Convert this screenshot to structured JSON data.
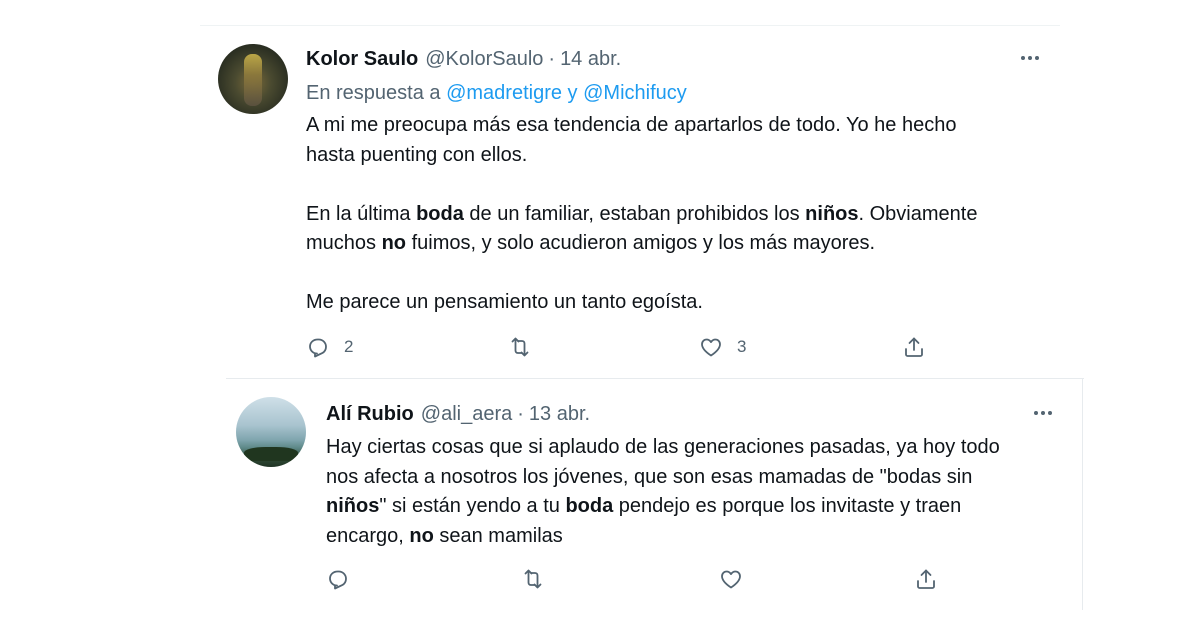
{
  "tweets": [
    {
      "name": "Kolor Saulo",
      "handle": "@KolorSaulo",
      "separator": "·",
      "date": "14 abr.",
      "reply_prefix": "En respuesta a",
      "reply_mentions": "@madretigre y @Michifucy",
      "body": {
        "p1_line1": "A mi me preocupa más esa tendencia de apartarlos de todo. Yo he hecho",
        "p1_line2": "hasta puenting con ellos.",
        "p2_a": "En la última ",
        "p2_b": "boda",
        "p2_c": " de un familiar, estaban prohibidos los ",
        "p2_d": "niños",
        "p2_e": ". Obviamente",
        "p2_f": "muchos ",
        "p2_g": "no",
        "p2_h": " fuimos, y solo acudieron amigos y los más mayores.",
        "p3": "Me parece un pensamiento un tanto egoísta."
      },
      "actions": {
        "reply_count": "2",
        "retweet_count": "",
        "like_count": "3"
      }
    },
    {
      "name": "Alí Rubio",
      "handle": "@ali_aera",
      "separator": "·",
      "date": "13 abr.",
      "body": {
        "l1": "Hay ciertas cosas que si aplaudo de las generaciones pasadas, ya hoy todo",
        "l2": "nos afecta a nosotros los jóvenes, que son esas mamadas de \"bodas sin",
        "l3_a": "niños",
        "l3_b": "\" si están yendo a tu ",
        "l3_c": "boda",
        "l3_d": " pendejo es porque los invitaste y traen",
        "l4_a": "encargo, ",
        "l4_b": "no",
        "l4_c": " sean mamilas"
      },
      "actions": {
        "reply_count": "",
        "retweet_count": "",
        "like_count": ""
      }
    }
  ],
  "icons": {
    "more": "more-horizontal-icon",
    "reply": "reply-icon",
    "retweet": "retweet-icon",
    "like": "heart-icon",
    "share": "share-icon"
  },
  "colors": {
    "text": "#0f1419",
    "secondary": "#536471",
    "link": "#1d9bf0",
    "divider": "#e7ebee"
  }
}
